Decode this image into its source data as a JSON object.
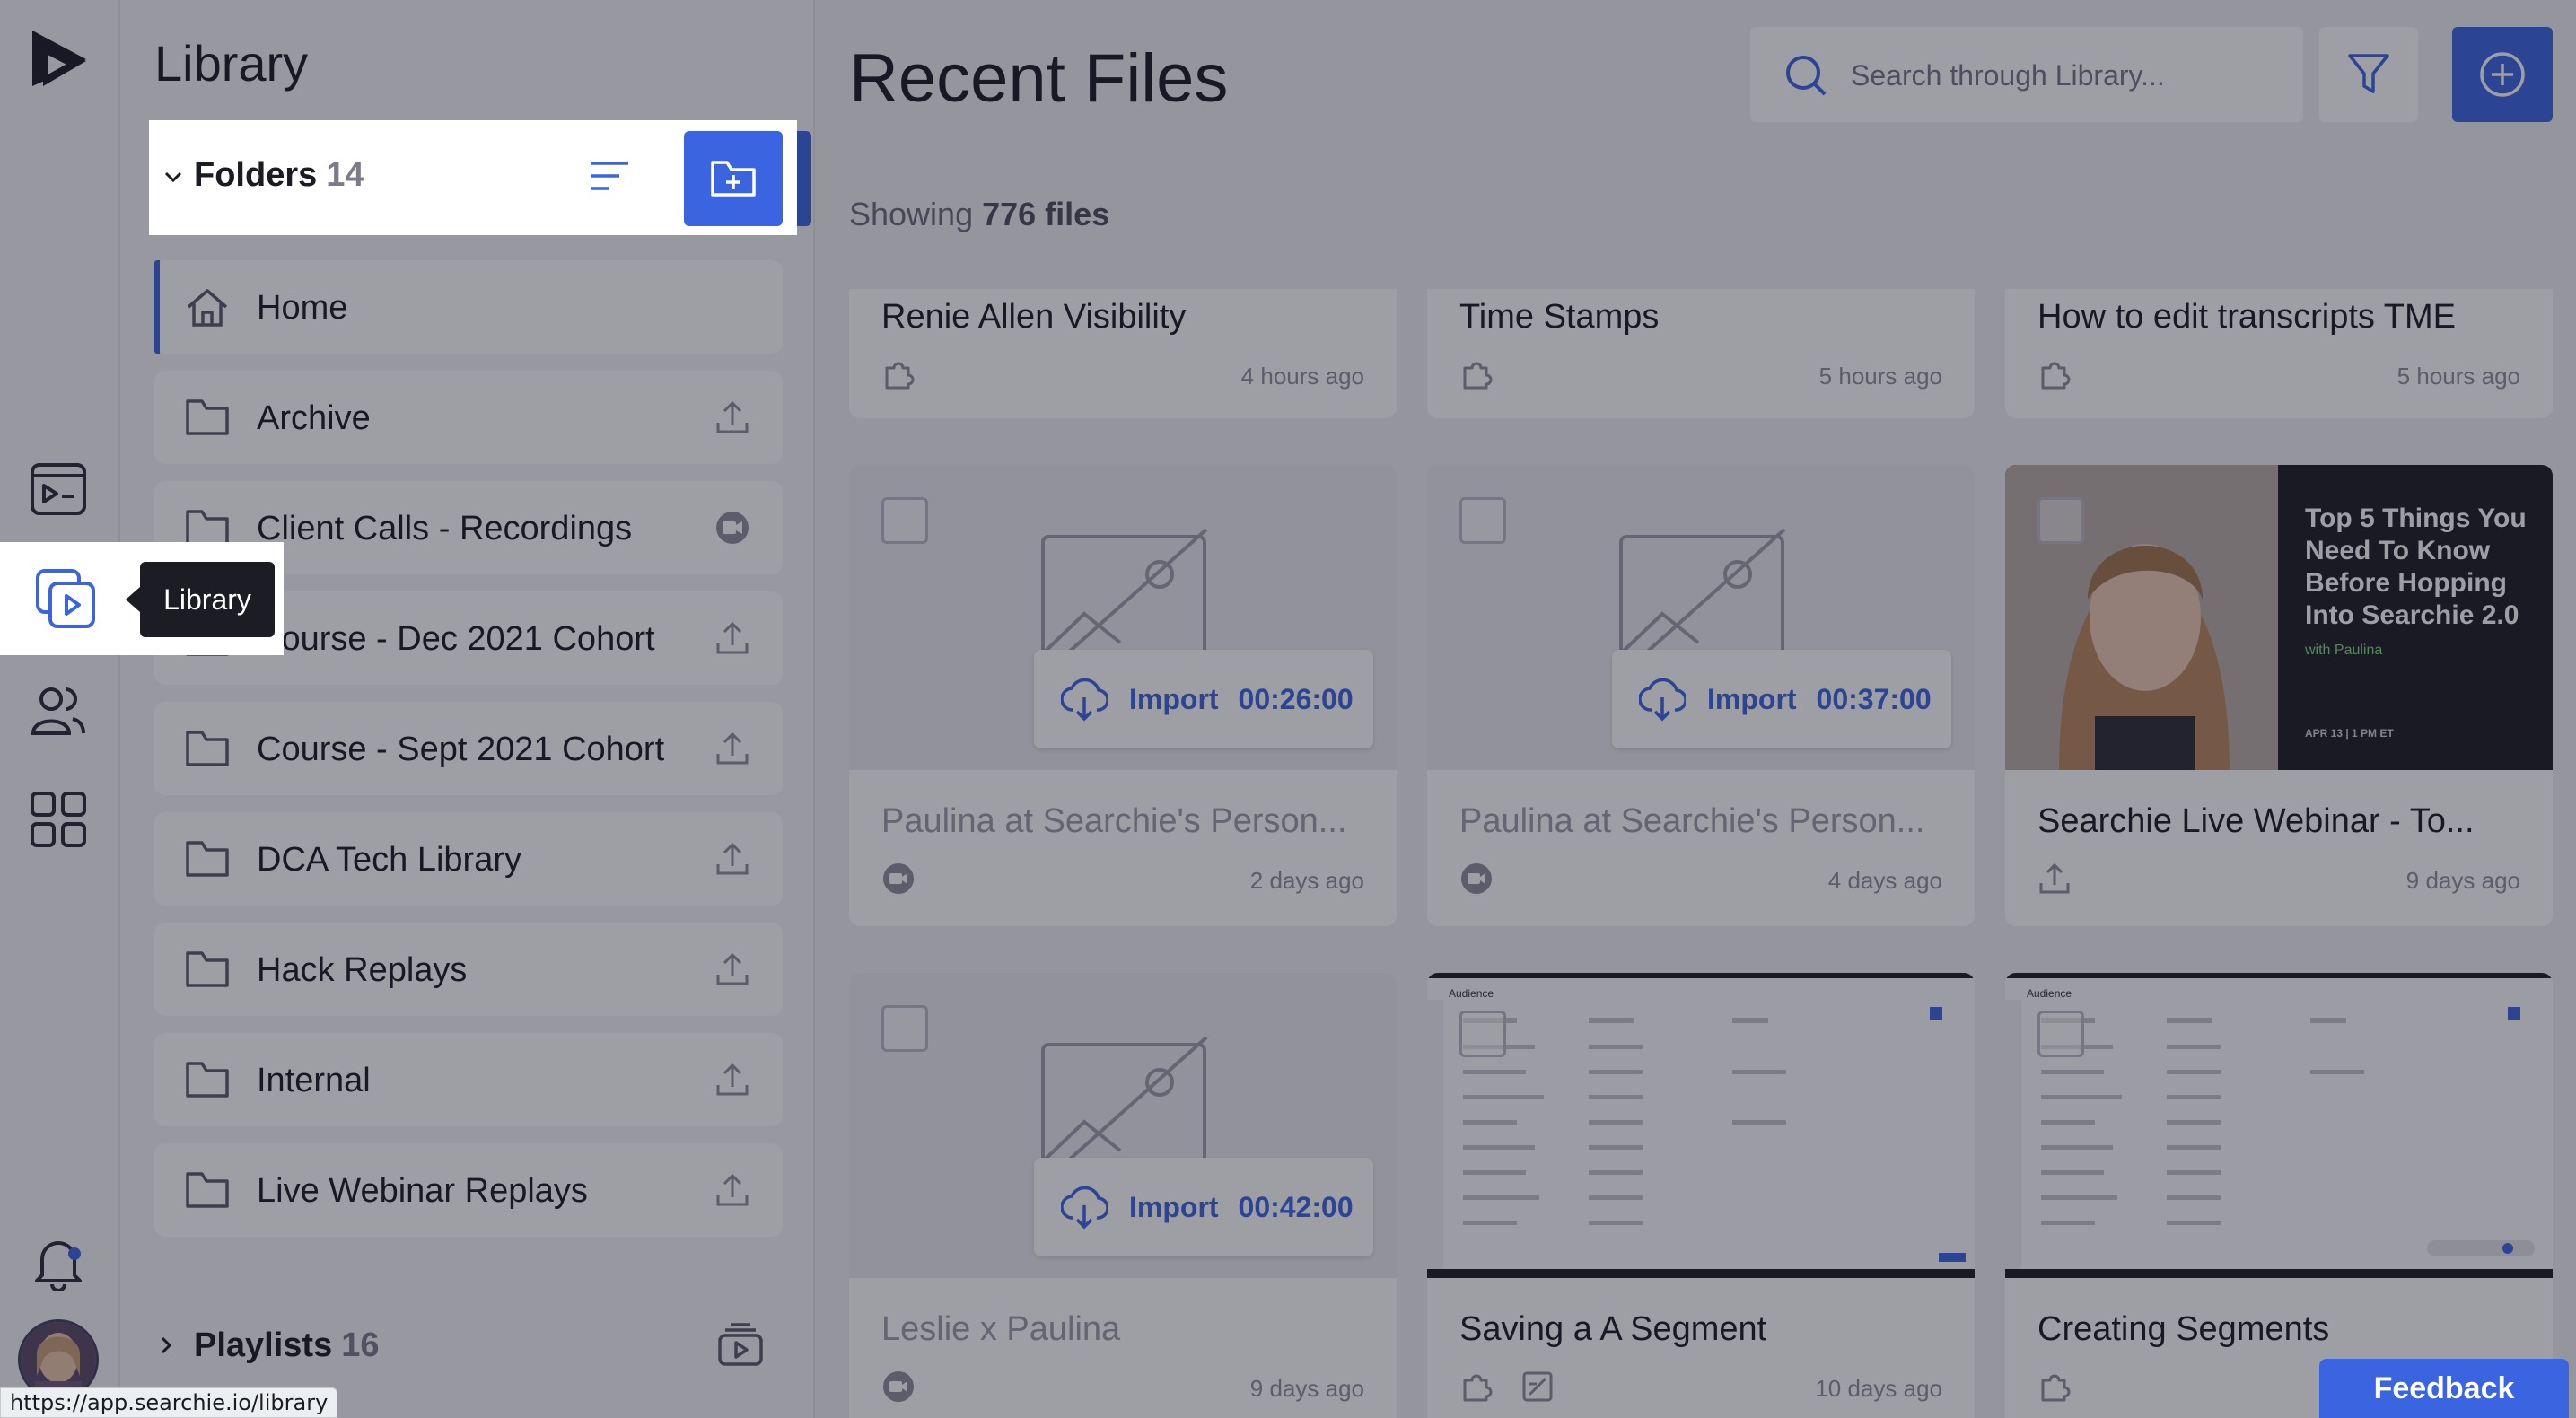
{
  "app": {
    "brand_color": "#3a64e0",
    "rail": {
      "items": [
        {
          "icon": "media-player-icon"
        },
        {
          "icon": "library-icon",
          "active": true
        },
        {
          "icon": "audience-icon"
        },
        {
          "icon": "apps-grid-icon"
        },
        {
          "icon": "bell-icon"
        }
      ]
    },
    "tooltip": "Library"
  },
  "library": {
    "title": "Library",
    "folders_label": "Folders",
    "folders_count": "14",
    "folders": [
      {
        "name": "Home",
        "action_icon": ""
      },
      {
        "name": "Archive",
        "action_icon": "upload-icon"
      },
      {
        "name": "Client Calls - Recordings",
        "action_icon": "video-badge-icon"
      },
      {
        "name": "Course - Dec 2021 Cohort",
        "action_icon": "upload-icon"
      },
      {
        "name": "Course - Sept 2021 Cohort",
        "action_icon": "upload-icon"
      },
      {
        "name": "DCA Tech Library",
        "action_icon": "upload-icon"
      },
      {
        "name": "Hack Replays",
        "action_icon": "upload-icon"
      },
      {
        "name": "Internal",
        "action_icon": "upload-icon"
      },
      {
        "name": "Live Webinar Replays",
        "action_icon": "upload-icon"
      }
    ],
    "playlists_label": "Playlists",
    "playlists_count": "16"
  },
  "main": {
    "title": "Recent Files",
    "search_placeholder": "Search through Library...",
    "showing_prefix": "Showing",
    "showing_count": "776 files",
    "cards": [
      {
        "title": "Renie Allen Visibility",
        "time": "4 hours ago"
      },
      {
        "title": "Time Stamps",
        "time": "5 hours ago"
      },
      {
        "title": "How to edit transcripts TME",
        "time": "5 hours ago"
      },
      {
        "title": "Paulina at Searchie's Person...",
        "time": "2 days ago",
        "import_label": "Import",
        "duration": "00:26:00"
      },
      {
        "title": "Paulina at Searchie's Person...",
        "time": "4 days ago",
        "import_label": "Import",
        "duration": "00:37:00"
      },
      {
        "title": "Searchie Live Webinar - To...",
        "time": "9 days ago",
        "thumb_text": "Top 5 Things You Need To Know Before Hopping Into Searchie 2.0",
        "thumb_sub": "with Paulina",
        "thumb_date": "APR 13 | 1 PM ET"
      },
      {
        "title": "Leslie x Paulina",
        "time": "9 days ago",
        "import_label": "Import",
        "duration": "00:42:00"
      },
      {
        "title": "Saving a A Segment",
        "time": "10 days ago",
        "thumb_header": "Audience"
      },
      {
        "title": "Creating Segments",
        "time": "",
        "thumb_header": "Audience"
      }
    ]
  },
  "status_url": "https://app.searchie.io/library",
  "feedback_label": "Feedback"
}
